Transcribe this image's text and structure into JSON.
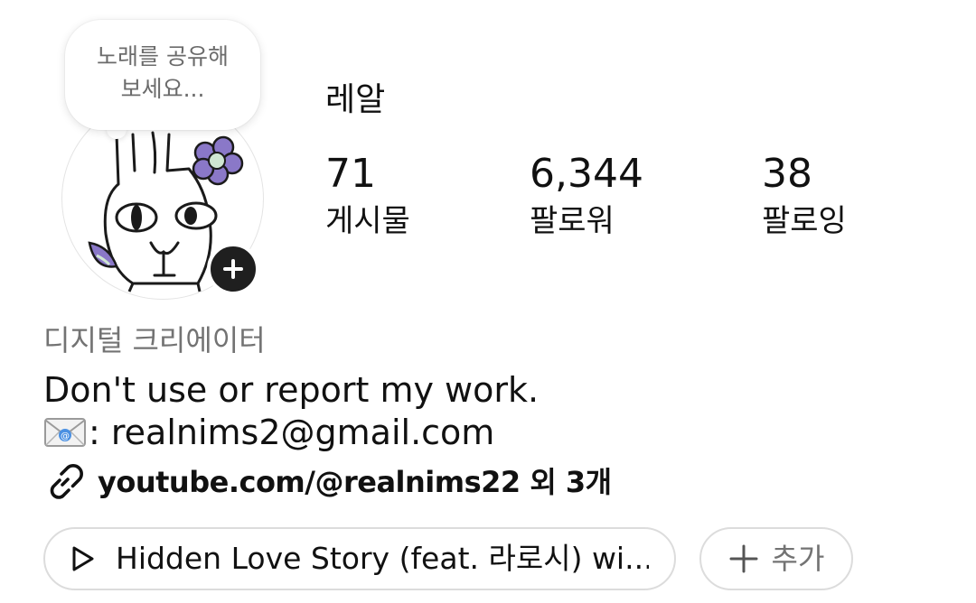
{
  "note": {
    "text": "노래를 공유해\n보세요..."
  },
  "profile": {
    "name": "레알"
  },
  "stats": {
    "posts": {
      "count": "71",
      "label": "게시물"
    },
    "followers": {
      "count": "6,344",
      "label": "팔로워"
    },
    "following": {
      "count": "38",
      "label": "팔로잉"
    }
  },
  "bio": {
    "category": "디지털 크리에이터",
    "line1": "Don't use or report my work.",
    "email_text": ": realnims2@gmail.com",
    "link_text": "youtube.com/@realnims22 외 3개"
  },
  "music": {
    "song": "Hidden Love Story (feat. 라로시) wi...",
    "add_label": "추가"
  },
  "icons": {
    "email": "envelope-emoji-icon",
    "link": "link-icon",
    "play": "play-icon",
    "plus": "plus-icon",
    "add_story": "plus-circle-icon"
  },
  "colors": {
    "primary_text": "#111111",
    "secondary_text": "#737373",
    "border": "#dcdcdc",
    "avatar_flower": "#8a78c8"
  }
}
